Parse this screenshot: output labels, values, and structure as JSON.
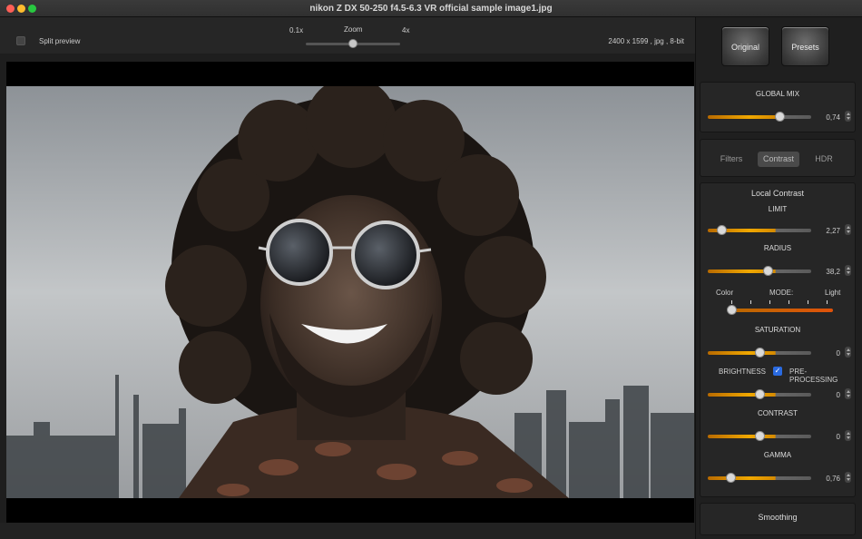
{
  "window": {
    "title": "nikon Z DX 50-250 f4.5-6.3 VR official sample image1.jpg"
  },
  "toolbar": {
    "split_preview_label": "Split preview",
    "zoom_label": "Zoom",
    "zoom_min": "0.1x",
    "zoom_max": "4x",
    "image_info": "2400 x 1599 , jpg , 8-bit"
  },
  "panel": {
    "original_button": "Original",
    "presets_button": "Presets",
    "global_mix": {
      "title": "GLOBAL MIX",
      "value": "0,74"
    },
    "tabs": [
      "Filters",
      "Contrast",
      "HDR"
    ],
    "active_tab": "Contrast",
    "local_contrast": {
      "title": "Local Contrast",
      "limit": {
        "label": "LIMIT",
        "value": "2,27"
      },
      "radius": {
        "label": "RADIUS",
        "value": "38,2"
      },
      "mode": {
        "label": "MODE:",
        "left": "Color",
        "right": "Light"
      },
      "saturation": {
        "label": "SATURATION",
        "value": "0"
      },
      "brightness": {
        "label": "BRIGHTNESS",
        "value": "0"
      },
      "preprocessing": {
        "label": "PRE-PROCESSING",
        "checked": true
      },
      "contrast": {
        "label": "CONTRAST",
        "value": "0"
      },
      "gamma": {
        "label": "GAMMA",
        "value": "0,76"
      }
    },
    "smoothing": {
      "title": "Smoothing"
    }
  },
  "colors": {
    "accent": "#f0a800",
    "checkbox_blue": "#2a6ae0",
    "background": "#1e1e1e"
  },
  "icons": [
    "close-icon",
    "minimize-icon",
    "zoom-window-icon",
    "stepper-icon",
    "checkmark-icon"
  ]
}
